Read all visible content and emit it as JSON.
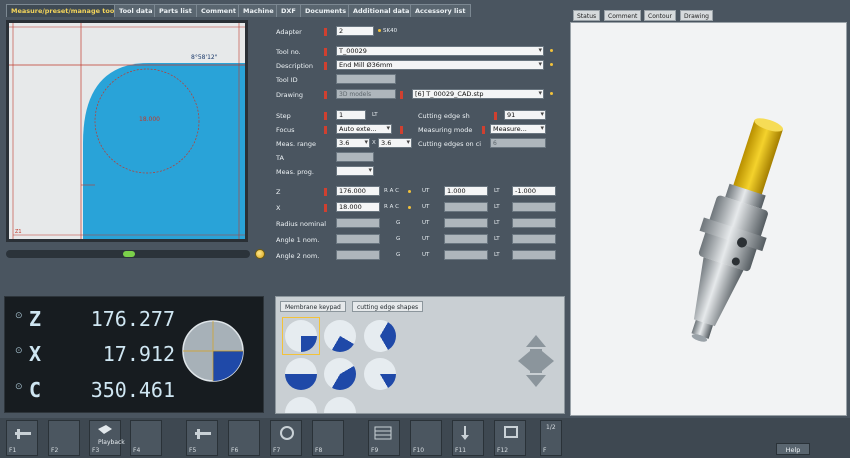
{
  "tabs": [
    "Measure/preset/manage tool",
    "Tool data",
    "Parts list",
    "Comment",
    "Machine",
    "DXF",
    "Documents",
    "Additional data",
    "Accessory list"
  ],
  "right_tabs": [
    "Status",
    "Comment",
    "Contour",
    "Drawing"
  ],
  "preview": {
    "angle_label": "8°58'12\"",
    "center_label": "18.000",
    "corner_label": "Z1"
  },
  "form": {
    "adapter_label": "Adapter",
    "adapter_value": "2",
    "adapter_extra": "SK40",
    "tool_no_label": "Tool no.",
    "tool_no_value": "T_00029",
    "description_label": "Description",
    "description_value": "End Mill Ø36mm",
    "tool_id_label": "Tool ID",
    "drawing_label": "Drawing",
    "drawing_btn": "3D models",
    "drawing_value": "[6] T_00029_CAD.stp",
    "step_label": "Step",
    "step_value": "1",
    "cutting_edge_label": "Cutting edge sh",
    "cutting_edge_value": "91",
    "focus_label": "Focus",
    "focus_value": "Auto exte...",
    "measuring_mode_label": "Measuring mode",
    "measuring_mode_value": "Measure...",
    "meas_range_label": "Meas. range",
    "meas_range_x": "3.6",
    "meas_range_sep": "X",
    "meas_range_y": "3.6",
    "cutting_edges_label": "Cutting edges on ci",
    "cutting_edges_value": "6",
    "ta_label": "TA",
    "meas_prog_label": "Meas. prog."
  },
  "values": {
    "z_label": "Z",
    "z_value": "176.000",
    "x_label": "X",
    "x_value": "18.000",
    "radius_label": "Radius nominal",
    "angle1_label": "Angle 1 nom.",
    "angle2_label": "Angle 2 nom.",
    "rac": "R A C",
    "ut_label": "UT",
    "ut_value": "1.000",
    "lt_label": "LT",
    "lt_value": "-1.000",
    "g_label": "G"
  },
  "dro": {
    "rows": [
      {
        "axis": "Z",
        "value": "176.277"
      },
      {
        "axis": "X",
        "value": "17.912"
      },
      {
        "axis": "C",
        "value": "350.461"
      }
    ]
  },
  "shapes": {
    "tab1": "Membrane keypad",
    "tab2": "cutting edge shapes"
  },
  "fkeys": [
    "F1",
    "F2",
    "F3",
    "F4",
    "F5",
    "F6",
    "F7",
    "F8",
    "F9",
    "F10",
    "F11",
    "F12",
    "F"
  ],
  "fkey_extra": {
    "f3": "Playback",
    "f_top": "1/2"
  },
  "help": "Help",
  "colors": {
    "accent": "#f3d45a",
    "preview_blue": "#29a3d8",
    "pie_blue": "#1f49a8"
  }
}
